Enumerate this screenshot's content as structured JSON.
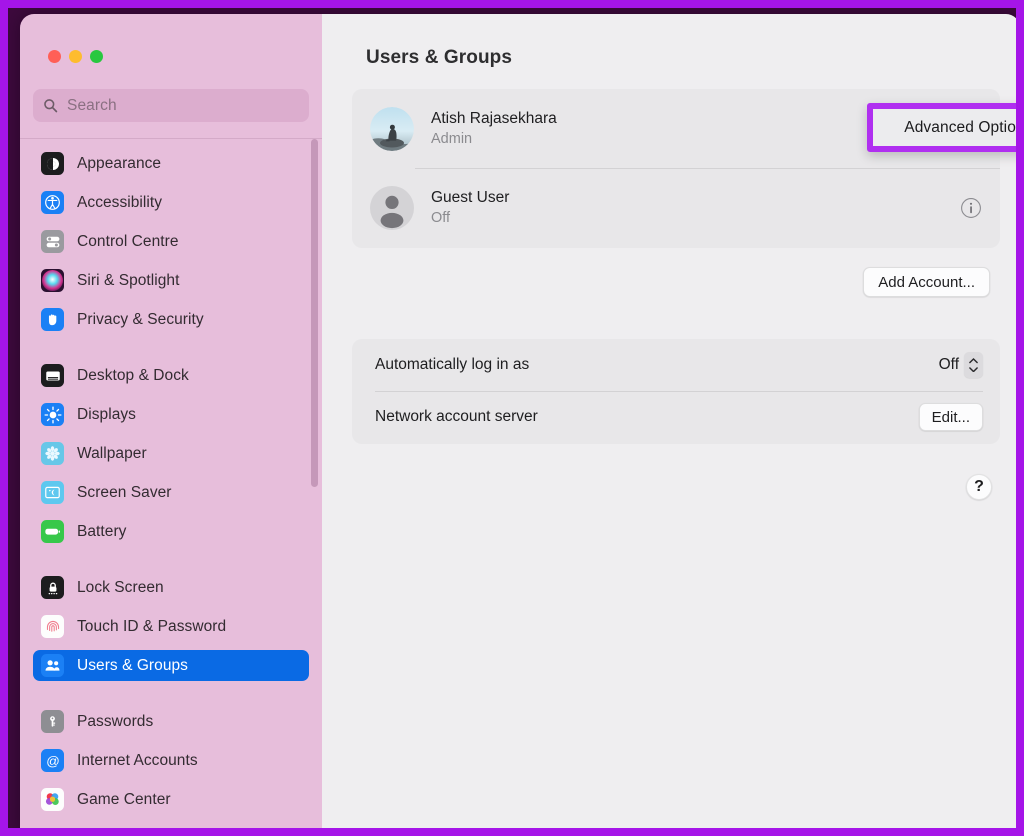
{
  "window": {
    "traffic_lights": [
      {
        "name": "close",
        "color": "#ff5f57"
      },
      {
        "name": "minimize",
        "color": "#febc2e"
      },
      {
        "name": "zoom",
        "color": "#28c840"
      }
    ]
  },
  "search": {
    "placeholder": "Search",
    "value": "",
    "icon": "search-icon"
  },
  "sidebar": {
    "groups": [
      {
        "items": [
          {
            "label": "Appearance",
            "icon": "appearance-icon",
            "selected": false
          },
          {
            "label": "Accessibility",
            "icon": "accessibility-icon",
            "selected": false
          },
          {
            "label": "Control Centre",
            "icon": "control-centre-icon",
            "selected": false
          },
          {
            "label": "Siri & Spotlight",
            "icon": "siri-spotlight-icon",
            "selected": false
          },
          {
            "label": "Privacy & Security",
            "icon": "privacy-security-icon",
            "selected": false
          }
        ]
      },
      {
        "items": [
          {
            "label": "Desktop & Dock",
            "icon": "desktop-dock-icon",
            "selected": false
          },
          {
            "label": "Displays",
            "icon": "displays-icon",
            "selected": false
          },
          {
            "label": "Wallpaper",
            "icon": "wallpaper-icon",
            "selected": false
          },
          {
            "label": "Screen Saver",
            "icon": "screen-saver-icon",
            "selected": false
          },
          {
            "label": "Battery",
            "icon": "battery-icon",
            "selected": false
          }
        ]
      },
      {
        "items": [
          {
            "label": "Lock Screen",
            "icon": "lock-screen-icon",
            "selected": false
          },
          {
            "label": "Touch ID & Password",
            "icon": "touch-id-icon",
            "selected": false
          },
          {
            "label": "Users & Groups",
            "icon": "users-groups-icon",
            "selected": true
          }
        ]
      },
      {
        "items": [
          {
            "label": "Passwords",
            "icon": "passwords-icon",
            "selected": false
          },
          {
            "label": "Internet Accounts",
            "icon": "internet-accounts-icon",
            "selected": false
          },
          {
            "label": "Game Center",
            "icon": "game-center-icon",
            "selected": false
          }
        ]
      }
    ],
    "selected_color": "#0a6ae4",
    "background_color": "#e7bedb"
  },
  "main": {
    "title": "Users & Groups",
    "accounts": [
      {
        "name": "Atish Rajasekhara",
        "role": "Admin",
        "avatar": "user-photo-avatar",
        "info_icon": "info-circle-icon"
      },
      {
        "name": "Guest User",
        "role": "Off",
        "avatar": "default-person-avatar",
        "info_icon": "info-circle-icon"
      }
    ],
    "add_account_label": "Add Account...",
    "settings": [
      {
        "label": "Automatically log in as",
        "value": "Off",
        "control": "stepper"
      },
      {
        "label": "Network account server",
        "value": "Edit...",
        "control": "button"
      }
    ],
    "help_label": "?"
  },
  "context_menu": {
    "label": "Advanced Options...",
    "highlight_color": "#b02ff0"
  },
  "annotation": {
    "frame_color": "#a515e8"
  }
}
